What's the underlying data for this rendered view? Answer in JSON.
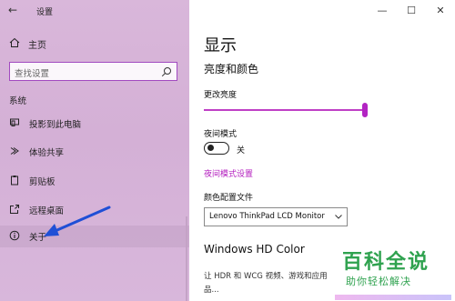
{
  "window": {
    "title": "设置",
    "controls": {
      "minimize": "—",
      "maximize": "☐",
      "close": "✕"
    }
  },
  "sidebar": {
    "home_label": "主页",
    "search_placeholder": "查找设置",
    "section_title": "系统",
    "items": [
      {
        "label": "投影到此电脑",
        "icon": "projector-icon"
      },
      {
        "label": "体验共享",
        "icon": "share-experience-icon"
      },
      {
        "label": "剪贴板",
        "icon": "clipboard-icon"
      },
      {
        "label": "远程桌面",
        "icon": "remote-desktop-icon"
      },
      {
        "label": "关于",
        "icon": "info-icon",
        "active": true
      }
    ]
  },
  "main": {
    "page_title": "显示",
    "sub_heading": "亮度和颜色",
    "brightness": {
      "label": "更改亮度",
      "value_fraction": 0.97
    },
    "night_mode": {
      "label": "夜间模式",
      "state_text": "关",
      "on": false
    },
    "night_settings_link": "夜间模式设置",
    "color_profile": {
      "label": "颜色配置文件",
      "value": "Lenovo ThinkPad LCD Monitor"
    },
    "hd_color": {
      "heading": "Windows HD Color",
      "description": "让 HDR 和 WCG 视频、游戏和应用",
      "description2": "品..."
    }
  },
  "watermark": {
    "title": "百科全说",
    "subtitle": "助你轻松解决"
  },
  "colors": {
    "accent": "#b324c3",
    "sidebar_bg": "#d4b0d6",
    "watermark_green": "#2fa24f",
    "arrow": "#1f4fd6"
  }
}
